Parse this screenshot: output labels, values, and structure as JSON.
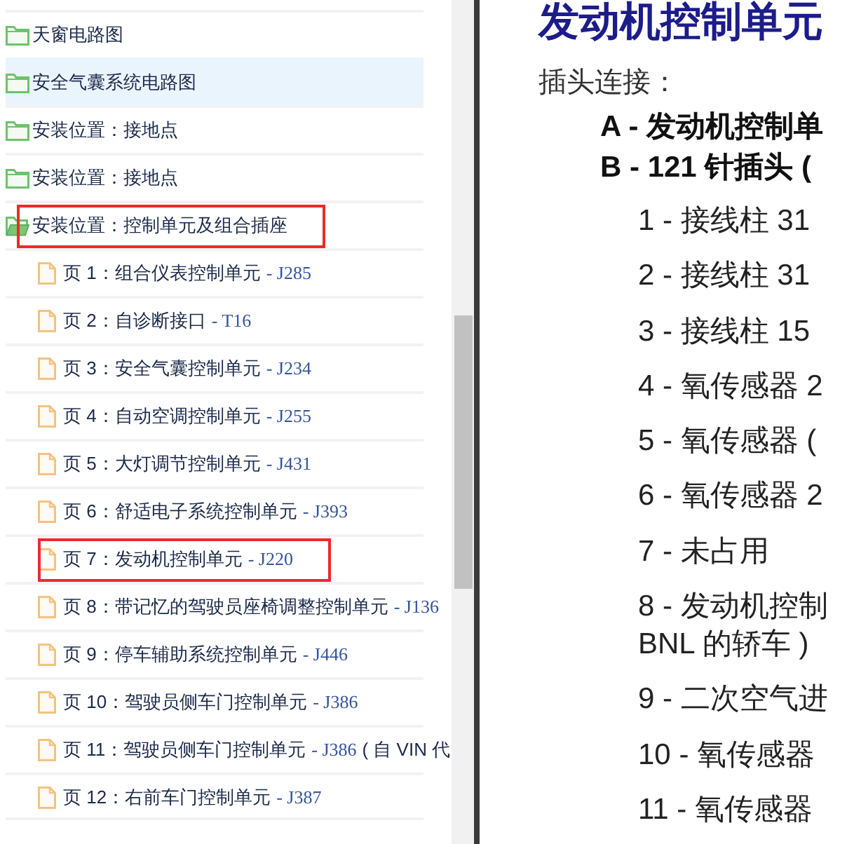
{
  "tree": [
    {
      "kind": "folder",
      "label": "天窗电路图",
      "expanded": false,
      "hovered": false,
      "marked": false
    },
    {
      "kind": "folder",
      "label": "安全气囊系统电路图",
      "expanded": false,
      "hovered": true,
      "marked": false
    },
    {
      "kind": "folder",
      "label": "安装位置：接地点",
      "expanded": false,
      "hovered": false,
      "marked": false
    },
    {
      "kind": "folder",
      "label": "安装位置：接地点",
      "expanded": false,
      "hovered": false,
      "marked": false
    },
    {
      "kind": "folder",
      "label": "安装位置：控制单元及组合插座",
      "expanded": true,
      "hovered": false,
      "marked": true,
      "children": [
        {
          "kind": "page",
          "label": "页 1：组合仪表控制单元",
          "code": "- J285",
          "hovered": false,
          "marked": false
        },
        {
          "kind": "page",
          "label": "页 2：自诊断接口",
          "code": "- T16",
          "hovered": false,
          "marked": false
        },
        {
          "kind": "page",
          "label": "页 3：安全气囊控制单元",
          "code": "- J234",
          "hovered": false,
          "marked": false
        },
        {
          "kind": "page",
          "label": "页 4：自动空调控制单元",
          "code": "- J255",
          "hovered": false,
          "marked": false
        },
        {
          "kind": "page",
          "label": "页 5：大灯调节控制单元",
          "code": "- J431",
          "hovered": false,
          "marked": false
        },
        {
          "kind": "page",
          "label": "页 6：舒适电子系统控制单元",
          "code": "- J393",
          "hovered": false,
          "marked": false
        },
        {
          "kind": "page",
          "label": "页 7：发动机控制单元",
          "code": "- J220",
          "hovered": false,
          "marked": true
        },
        {
          "kind": "page",
          "label": "页 8：带记忆的驾驶员座椅调整控制单元",
          "code": "- J136",
          "hovered": false,
          "marked": false
        },
        {
          "kind": "page",
          "label": "页 9：停车辅助系统控制单元",
          "code": "- J446",
          "hovered": false,
          "marked": false
        },
        {
          "kind": "page",
          "label": "页 10：驾驶员侧车门控制单元",
          "code": "- J386",
          "hovered": false,
          "marked": false
        },
        {
          "kind": "page",
          "label": "页 11：驾驶员侧车门控制单元",
          "code": "- J386",
          "note": "( 自 VIN 代",
          "hovered": false,
          "marked": false
        },
        {
          "kind": "page",
          "label": "页 12：右前车门控制单元",
          "code": "- J387",
          "hovered": false,
          "marked": false
        }
      ]
    }
  ],
  "document": {
    "title": "发动机控制单元",
    "intro": "插头连接：",
    "connectors": [
      "A - 发动机控制单",
      "B - 121 针插头 ("
    ],
    "pins": [
      {
        "lines": [
          "1 - 接线柱 31"
        ]
      },
      {
        "lines": [
          "2 - 接线柱 31"
        ]
      },
      {
        "lines": [
          "3 - 接线柱 15"
        ]
      },
      {
        "lines": [
          "4 - 氧传感器 2"
        ]
      },
      {
        "lines": [
          "5 - 氧传感器 ("
        ]
      },
      {
        "lines": [
          "6 - 氧传感器 2"
        ]
      },
      {
        "lines": [
          "7 - 未占用"
        ]
      },
      {
        "lines": [
          "8 - 发动机控制",
          "BNL 的轿车 )"
        ]
      },
      {
        "lines": [
          "9 - 二次空气进"
        ]
      },
      {
        "lines": [
          "10 - 氧传感器"
        ]
      },
      {
        "lines": [
          "11 - 氧传感器"
        ]
      }
    ]
  }
}
